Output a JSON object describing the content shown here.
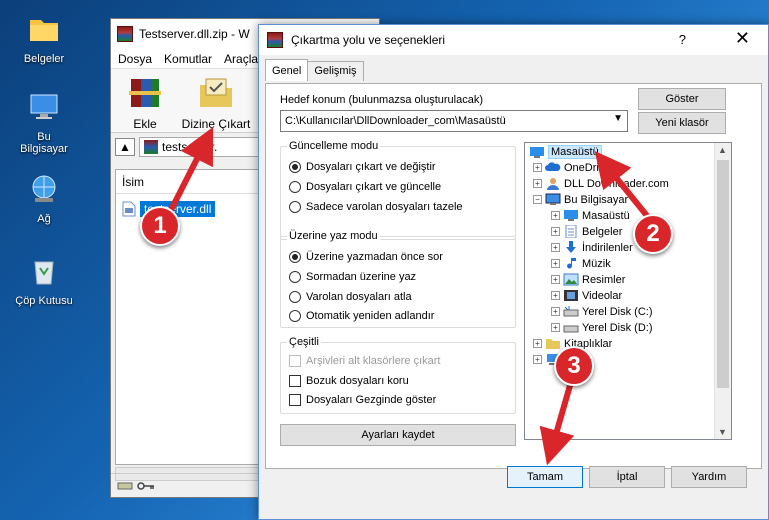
{
  "desktop": {
    "icons": [
      {
        "label": "Belgeler"
      },
      {
        "label": "Bu Bilgisayar"
      },
      {
        "label": "Ağ"
      },
      {
        "label": "Çöp Kutusu"
      }
    ]
  },
  "rar": {
    "title": "Testserver.dll.zip - W",
    "menu": [
      "Dosya",
      "Komutlar",
      "Araçla"
    ],
    "toolbar": {
      "add_label": "Ekle",
      "extract_label": "Dizine Çıkart"
    },
    "address": "testserver.",
    "list_header": "İsim",
    "file_name": "testserver.dll"
  },
  "dialog": {
    "title": "Çıkartma yolu ve seçenekleri",
    "help": "?",
    "close": "✕",
    "tabs": [
      "Genel",
      "Gelişmiş"
    ],
    "target_label": "Hedef konum (bulunmazsa oluşturulacak)",
    "target_value": "C:\\Kullanıcılar\\DllDownloader_com\\Masaüstü",
    "show_button": "Göster",
    "new_folder_button": "Yeni klasör",
    "update_mode": {
      "title": "Güncelleme modu",
      "options": [
        "Dosyaları çıkart ve değiştir",
        "Dosyaları çıkart ve güncelle",
        "Sadece varolan dosyaları tazele"
      ]
    },
    "overwrite_mode": {
      "title": "Üzerine yaz modu",
      "options": [
        "Üzerine yazmadan önce sor",
        "Sormadan üzerine yaz",
        "Varolan dosyaları atla",
        "Otomatik yeniden adlandır"
      ]
    },
    "misc": {
      "title": "Çeşitli",
      "options": [
        "Arşivleri alt klasörlere çıkart",
        "Bozuk dosyaları koru",
        "Dosyaları Gezginde göster"
      ]
    },
    "save_settings": "Ayarları kaydet",
    "tree": [
      "Masaüstü",
      "OneDrive",
      "DLL Downloader.com",
      "Bu Bilgisayar",
      "Masaüstü",
      "Belgeler",
      "İndirilenler",
      "Müzik",
      "Resimler",
      "Videolar",
      "Yerel Disk (C:)",
      "Yerel Disk (D:)",
      "Kitaplıklar",
      "Ağ"
    ],
    "ok_button": "Tamam",
    "cancel_button": "İptal",
    "help_button": "Yardım"
  },
  "markers": [
    "1",
    "2",
    "3"
  ],
  "colors": {
    "accent": "#0078d7",
    "marker": "#d9262a"
  }
}
